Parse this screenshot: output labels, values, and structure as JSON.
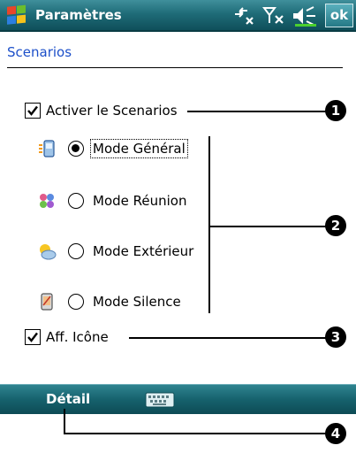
{
  "titlebar": {
    "title": "Paramètres",
    "ok_label": "ok",
    "icons": [
      "windows-start-icon",
      "connectivity-icon",
      "signal-off-icon",
      "speaker-icon"
    ]
  },
  "section": {
    "title": "Scenarios"
  },
  "enable_scenarios": {
    "label": "Activer le Scenarios",
    "checked": true
  },
  "modes": [
    {
      "label": "Mode Général",
      "selected": true,
      "icon": "general-mode-icon"
    },
    {
      "label": "Mode Réunion",
      "selected": false,
      "icon": "meeting-mode-icon"
    },
    {
      "label": "Mode Extérieur",
      "selected": false,
      "icon": "outdoor-mode-icon"
    },
    {
      "label": "Mode Silence",
      "selected": false,
      "icon": "silent-mode-icon"
    }
  ],
  "show_icon": {
    "label": "Aff. Icône",
    "checked": true
  },
  "menubar": {
    "left_label": "Détail",
    "center_icon": "keyboard-icon"
  },
  "callouts": [
    "1",
    "2",
    "3",
    "4"
  ],
  "colors": {
    "bar_teal": "#1f6c78",
    "section_title_blue": "#1c4fc9",
    "marker_black": "#000000"
  }
}
